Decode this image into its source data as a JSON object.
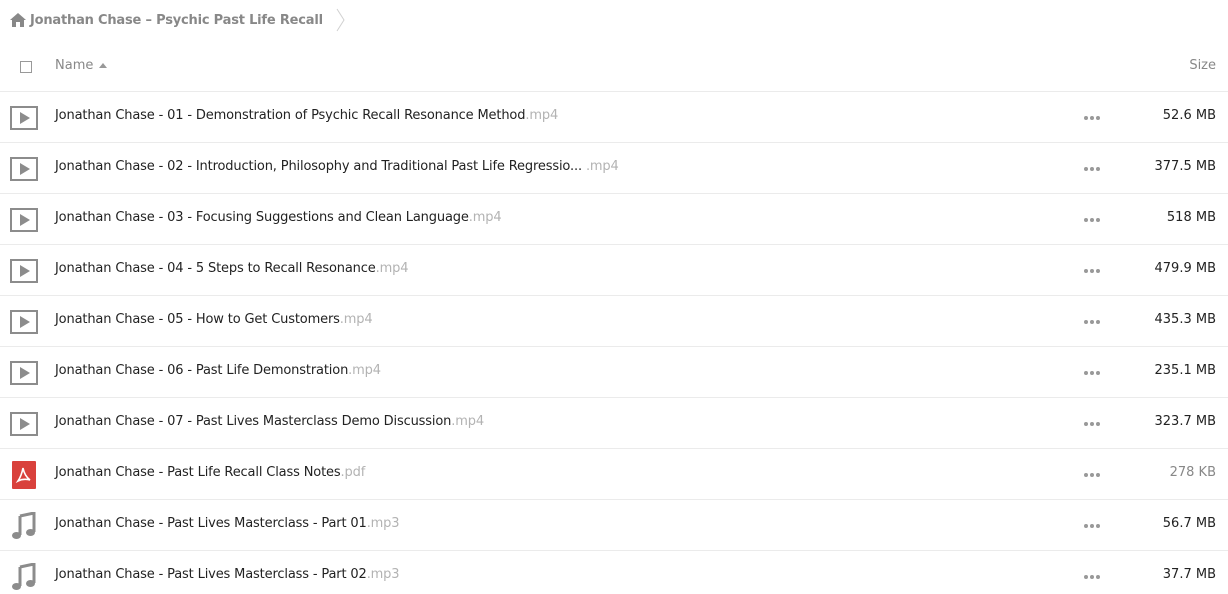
{
  "breadcrumb": {
    "home_icon": "home-icon",
    "folder_name": "Jonathan Chase – Psychic Past Life Recall"
  },
  "header": {
    "name_label": "Name",
    "sort_icon": "sort-ascending-icon",
    "size_label": "Size"
  },
  "files": [
    {
      "name": "Jonathan Chase - 01 - Demonstration of Psychic Recall Resonance Method",
      "ext": ".mp4",
      "size": "52.6 MB",
      "icon": "video-file-icon"
    },
    {
      "name": "Jonathan Chase - 02 - Introduction, Philosophy and Traditional Past Life Regressio... ",
      "ext": ".mp4",
      "size": "377.5 MB",
      "icon": "video-file-icon"
    },
    {
      "name": "Jonathan Chase - 03 - Focusing Suggestions and Clean Language",
      "ext": ".mp4",
      "size": "518 MB",
      "icon": "video-file-icon"
    },
    {
      "name": "Jonathan Chase - 04 - 5 Steps to Recall Resonance",
      "ext": ".mp4",
      "size": "479.9 MB",
      "icon": "video-file-icon"
    },
    {
      "name": "Jonathan Chase - 05 - How to Get Customers",
      "ext": ".mp4",
      "size": "435.3 MB",
      "icon": "video-file-icon"
    },
    {
      "name": "Jonathan Chase - 06 - Past Life Demonstration",
      "ext": ".mp4",
      "size": "235.1 MB",
      "icon": "video-file-icon"
    },
    {
      "name": "Jonathan Chase - 07 - Past Lives Masterclass Demo Discussion",
      "ext": ".mp4",
      "size": "323.7 MB",
      "icon": "video-file-icon"
    },
    {
      "name": "Jonathan Chase - Past Life Recall Class Notes",
      "ext": ".pdf",
      "size": "278 KB",
      "icon": "pdf-file-icon"
    },
    {
      "name": "Jonathan Chase - Past Lives Masterclass - Part 01",
      "ext": ".mp3",
      "size": "56.7 MB",
      "icon": "audio-file-icon"
    },
    {
      "name": "Jonathan Chase - Past Lives Masterclass - Part 02",
      "ext": ".mp3",
      "size": "37.7 MB",
      "icon": "audio-file-icon"
    }
  ],
  "colors": {
    "pdf_red": "#d9413c",
    "icon_gray": "#8c8c8c",
    "ext_gray": "#b3b3b3"
  }
}
